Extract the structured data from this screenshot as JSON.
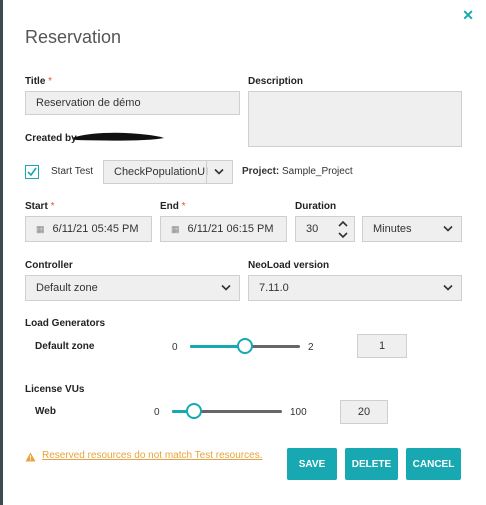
{
  "dialog": {
    "title": "Reservation"
  },
  "form": {
    "title_label": "Title",
    "title_value": "Reservation de démo",
    "description_label": "Description",
    "created_by_label": "Created by",
    "start_test_label": "Start Test",
    "test_select": "CheckPopulationUI",
    "project_label": "Project:",
    "project_value": "Sample_Project",
    "start_label": "Start",
    "start_value": "6/11/21 05:45 PM",
    "end_label": "End",
    "end_value": "6/11/21 06:15 PM",
    "duration_label": "Duration",
    "duration_value": "30",
    "duration_unit": "Minutes",
    "controller_label": "Controller",
    "controller_value": "Default zone",
    "neoload_label": "NeoLoad version",
    "neoload_value": "7.11.0",
    "load_generators_label": "Load Generators",
    "lg_zone_label": "Default zone",
    "lg_min": "0",
    "lg_max": "2",
    "lg_value": "1",
    "lg_fraction": 0.5,
    "license_label": "License VUs",
    "vu_label": "Web",
    "vu_min": "0",
    "vu_max": "100",
    "vu_value": "20",
    "vu_fraction": 0.2,
    "required_mark": "*"
  },
  "footer": {
    "warning": "Reserved resources do not match Test resources.",
    "save": "SAVE",
    "delete": "DELETE",
    "cancel": "CANCEL"
  },
  "colors": {
    "accent": "#17a8b1",
    "warning": "#e8a33d",
    "required": "#e74c3c"
  }
}
